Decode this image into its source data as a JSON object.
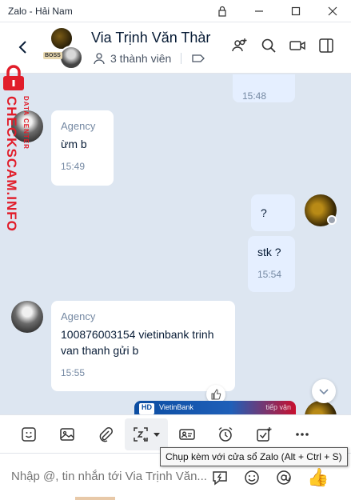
{
  "window": {
    "title": "Zalo - Hải Nam"
  },
  "header": {
    "group_name": "Via Trịnh Văn Thàr",
    "members_label": "3 thành viên",
    "avatar_badge": "BOSS"
  },
  "watermark": {
    "text": "CHECKSCAM.INFO",
    "subtext": "DATA CENTER"
  },
  "messages": [
    {
      "direction": "out",
      "text": "",
      "time": "15:48"
    },
    {
      "direction": "in",
      "sender": "Agency",
      "text": "ừm b",
      "time": "15:49"
    },
    {
      "direction": "out",
      "text": "?",
      "time": ""
    },
    {
      "direction": "out",
      "text": "stk ?",
      "time": "15:54"
    },
    {
      "direction": "in",
      "sender": "Agency",
      "text": "100876003154 vietinbank trinh van thanh gửi b",
      "time": "15:55"
    }
  ],
  "card_preview": {
    "badge": "HD",
    "bank": "VietinBank",
    "tail": "tiếp vận"
  },
  "tooltip": {
    "text": "Chụp kèm với cửa sổ Zalo (Alt + Ctrl + S)"
  },
  "composer": {
    "placeholder": "Nhập @, tin nhắn tới Via Trịnh Văn..."
  },
  "colors": {
    "accent": "#0068ff",
    "chat_bg": "#dde6f1",
    "out_bubble": "#e5efff",
    "watermark": "#e11d2a"
  }
}
